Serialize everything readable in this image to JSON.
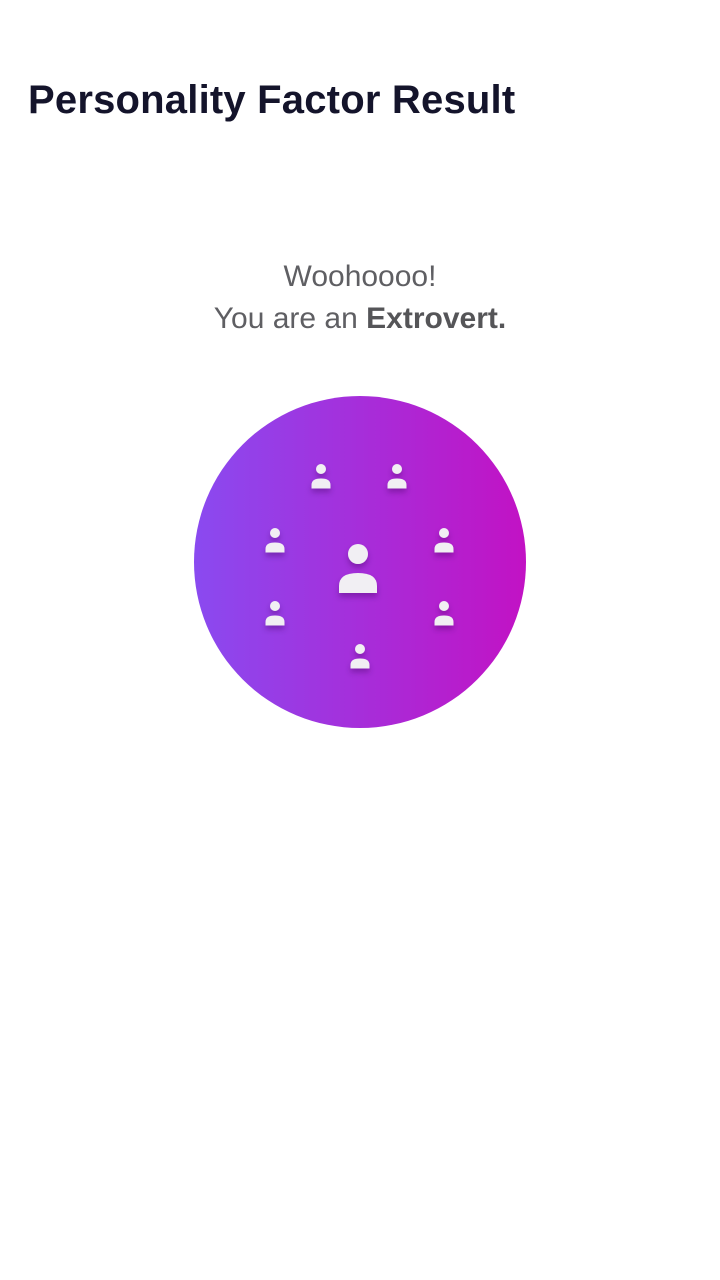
{
  "header": {
    "title": "Personality Factor Result"
  },
  "result": {
    "greeting": "Woohoooo!",
    "prefix": "You are an ",
    "type": "Extrovert",
    "suffix": ".",
    "illustration": {
      "icon": "group-people-icon",
      "gradient_start": "#8a4af0",
      "gradient_end": "#c212c4",
      "figure_color": "#f1eff3"
    }
  }
}
